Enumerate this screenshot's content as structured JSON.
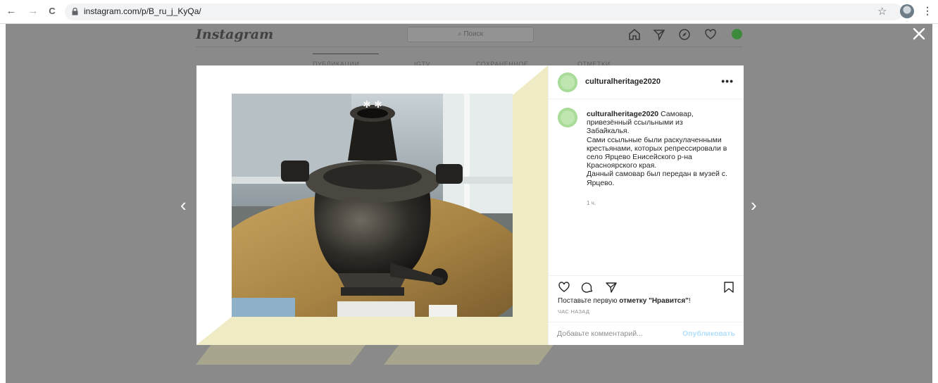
{
  "browser": {
    "back": "←",
    "forward": "→",
    "reload": "C",
    "url": "instagram.com/p/B_ru_j_KyQa/",
    "bookmark": "☆",
    "menu": "⋮"
  },
  "background_page": {
    "logo": "Instagram",
    "search_placeholder": "Поиск",
    "tabs": [
      "ПУБЛИКАЦИИ",
      "IGTV",
      "СОХРАНЕННОЕ",
      "ОТМЕТКИ"
    ]
  },
  "post": {
    "username": "culturalheritage2020",
    "more": "•••",
    "caption": "Самовар, привезённый ссыльными из Забайкалья.\nСами ссыльные были раскулаченными крестьянами, которых репрессировали в село Ярцево Енисейского р-на Красноярского края.\nДанный самовар был передан в музей с. Ярцево.",
    "caption_time": "1 ч.",
    "likes_prefix": "Поставьте первую ",
    "likes_bold": "отметку \"Нравится\"",
    "likes_suffix": "!",
    "post_time": "ЧАС НАЗАД",
    "comment_placeholder": "Добавьте комментарий...",
    "publish_label": "Опубликовать"
  },
  "navigation": {
    "prev": "‹",
    "next": "›"
  },
  "icons": {
    "lock": "lock-icon",
    "home": "home-icon",
    "direct": "paper-plane-icon",
    "explore": "compass-icon",
    "activity": "heart-icon",
    "like": "heart-icon",
    "comment": "speech-bubble-icon",
    "share": "paper-plane-icon",
    "save": "bookmark-icon",
    "close": "close-icon"
  },
  "colors": {
    "overlay": "#8a8a8a",
    "accent": "#efebc4",
    "avatar": "#bfe6b0",
    "publish": "#b2dffc"
  }
}
